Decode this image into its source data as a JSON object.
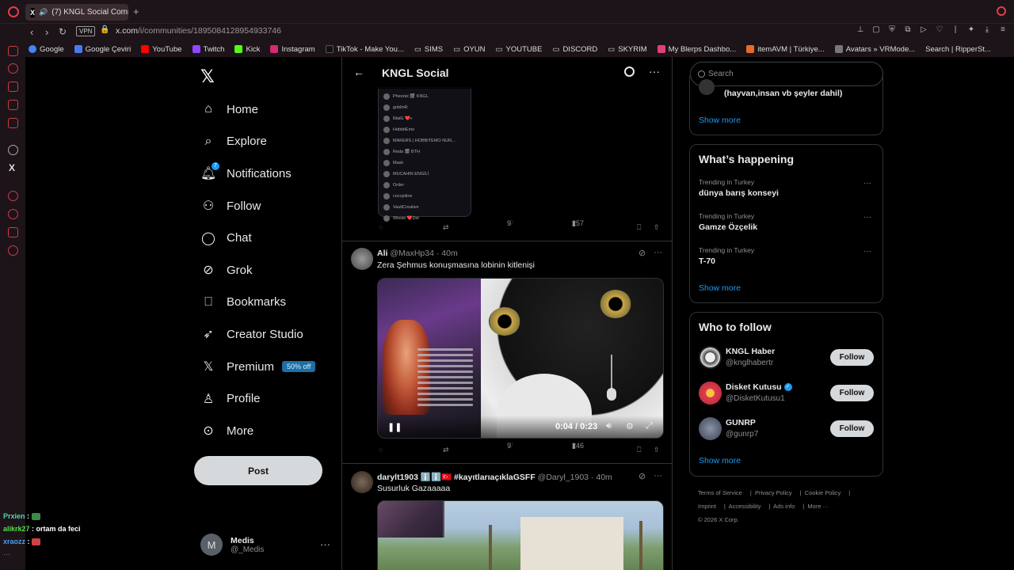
{
  "browser": {
    "tab_title": "(7) KNGL Social Comm",
    "url_domain": "x.com",
    "url_path": "/i/communities/1895084128954933746",
    "vpn_label": "VPN",
    "bookmarks": [
      "Google",
      "Google Çeviri",
      "YouTube",
      "Twitch",
      "Kick",
      "Instagram",
      "TikTok - Make You...",
      "SIMS",
      "OYUN",
      "YOUTUBE",
      "DISCORD",
      "SKYRIM",
      "My Blerps Dashbo...",
      "itemAVM | Türkiye...",
      "Avatars » VRMode...",
      "Search | RipperSt..."
    ]
  },
  "nav": {
    "items": [
      {
        "label": "Home",
        "icon": "home-icon"
      },
      {
        "label": "Explore",
        "icon": "search-icon"
      },
      {
        "label": "Notifications",
        "icon": "bell-icon",
        "badge": "7"
      },
      {
        "label": "Follow",
        "icon": "add-user-icon"
      },
      {
        "label": "Chat",
        "icon": "chat-icon"
      },
      {
        "label": "Grok",
        "icon": "grok-icon"
      },
      {
        "label": "Bookmarks",
        "icon": "bookmark-icon"
      },
      {
        "label": "Creator Studio",
        "icon": "rocket-icon"
      },
      {
        "label": "Premium",
        "icon": "x-icon",
        "tag": "50% off"
      },
      {
        "label": "Profile",
        "icon": "person-icon"
      },
      {
        "label": "More",
        "icon": "more-circle-icon"
      }
    ],
    "post_label": "Post",
    "account": {
      "name": "Medis",
      "handle": "@_Medis",
      "initial": "M"
    }
  },
  "main": {
    "title": "KNGL Social",
    "phone_rows": [
      "Pheonix 🎬 KNGL",
      "goblinR",
      "llilaiG ❤️◐",
      "HobbitEmo",
      "MAKERS | HOBBITEMO NUN...",
      "Reda 🎬 BTH",
      "Mask",
      "MUCAHIN ENGİLİ",
      "Order",
      "cocojoline",
      "VaultCreative",
      "Wissie ❤️Dst"
    ],
    "tweet0": {
      "likes": "9",
      "views": "257"
    },
    "tweet1": {
      "name": "Ali",
      "handle": "@MaxHp34",
      "time": "· 40m",
      "text": "Zera Şehmus konuşmasına lobinin kitlenişi",
      "video_time": "0:04 / 0:23",
      "likes": "9",
      "views": "246"
    },
    "tweet2": {
      "name": "darylt1903 ℹ️ℹ️🇹🇷 #kayıtlarıaçıklaGSFF",
      "handle": "@Daryl_1903",
      "time": "· 40m",
      "text": "Susurluk Gazaaaaa"
    }
  },
  "right": {
    "search_placeholder": "Search",
    "top_card_text": "(hayvan,insan vb şeyler dahil)",
    "show_more": "Show more",
    "happening_title": "What’s happening",
    "trends": [
      {
        "meta": "Trending in Turkey",
        "name": "dünya barış konseyi"
      },
      {
        "meta": "Trending in Turkey",
        "name": "Gamze Özçelik"
      },
      {
        "meta": "Trending in Turkey",
        "name": "T-70"
      }
    ],
    "wtf_title": "Who to follow",
    "follow_label": "Follow",
    "wtf": [
      {
        "name": "KNGL Haber",
        "handle": "@knglhabertr"
      },
      {
        "name": "Disket Kutusu",
        "handle": "@DisketKutusu1",
        "verified": true
      },
      {
        "name": "GUNRP",
        "handle": "@gunrp7"
      }
    ],
    "footer": [
      "Terms of Service",
      "Privacy Policy",
      "Cookie Policy",
      "Imprint",
      "Accessibility",
      "Ads info",
      "More ···",
      "© 2026 X Corp."
    ]
  },
  "chat_overlay": [
    {
      "user": "Prxien",
      "msg": ""
    },
    {
      "user": "alikrk27",
      "msg": "ortam da feci"
    },
    {
      "user": "xraozz",
      "msg": ""
    }
  ],
  "colors": {
    "accent": "#1d9bf0",
    "opera_red": "#e23b4e",
    "bg": "#000000"
  }
}
